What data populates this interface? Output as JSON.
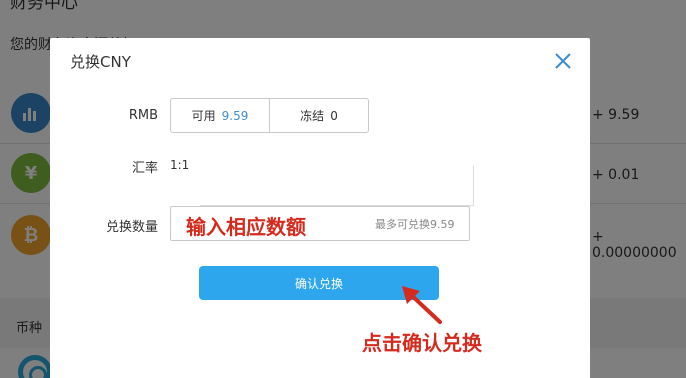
{
  "background": {
    "title": "财务中心",
    "description": "您的财务资产汇总如下",
    "assets": [
      {
        "icon": "bar-chart-icon",
        "glyph": "▮",
        "color": "#3a86c8",
        "value": "+ 9.59"
      },
      {
        "icon": "yen-icon",
        "glyph": "¥",
        "color": "#7dbb3f",
        "value": "+ 0.01"
      },
      {
        "icon": "bitcoin-icon",
        "glyph": "₿",
        "color": "#f0a22e",
        "value": "+ 0.00000000"
      }
    ],
    "table": {
      "column_label": "币种"
    }
  },
  "modal": {
    "title": "兑换CNY",
    "balance_label": "RMB",
    "available_label": "可用",
    "available_value": "9.59",
    "frozen_label": "冻结",
    "frozen_value": "0",
    "rate_label": "汇率",
    "rate_value": "1:1",
    "amount_label": "兑换数量",
    "amount_placeholder": "",
    "amount_hint": "最多可兑换9.59",
    "confirm_label": "确认兑换"
  },
  "annotations": {
    "input_hint": "输入相应数额",
    "click_hint": "点击确认兑换"
  },
  "colors": {
    "accent": "#2ea6ee",
    "annotation": "#d52b1e",
    "available_value": "#3e8ed0"
  }
}
